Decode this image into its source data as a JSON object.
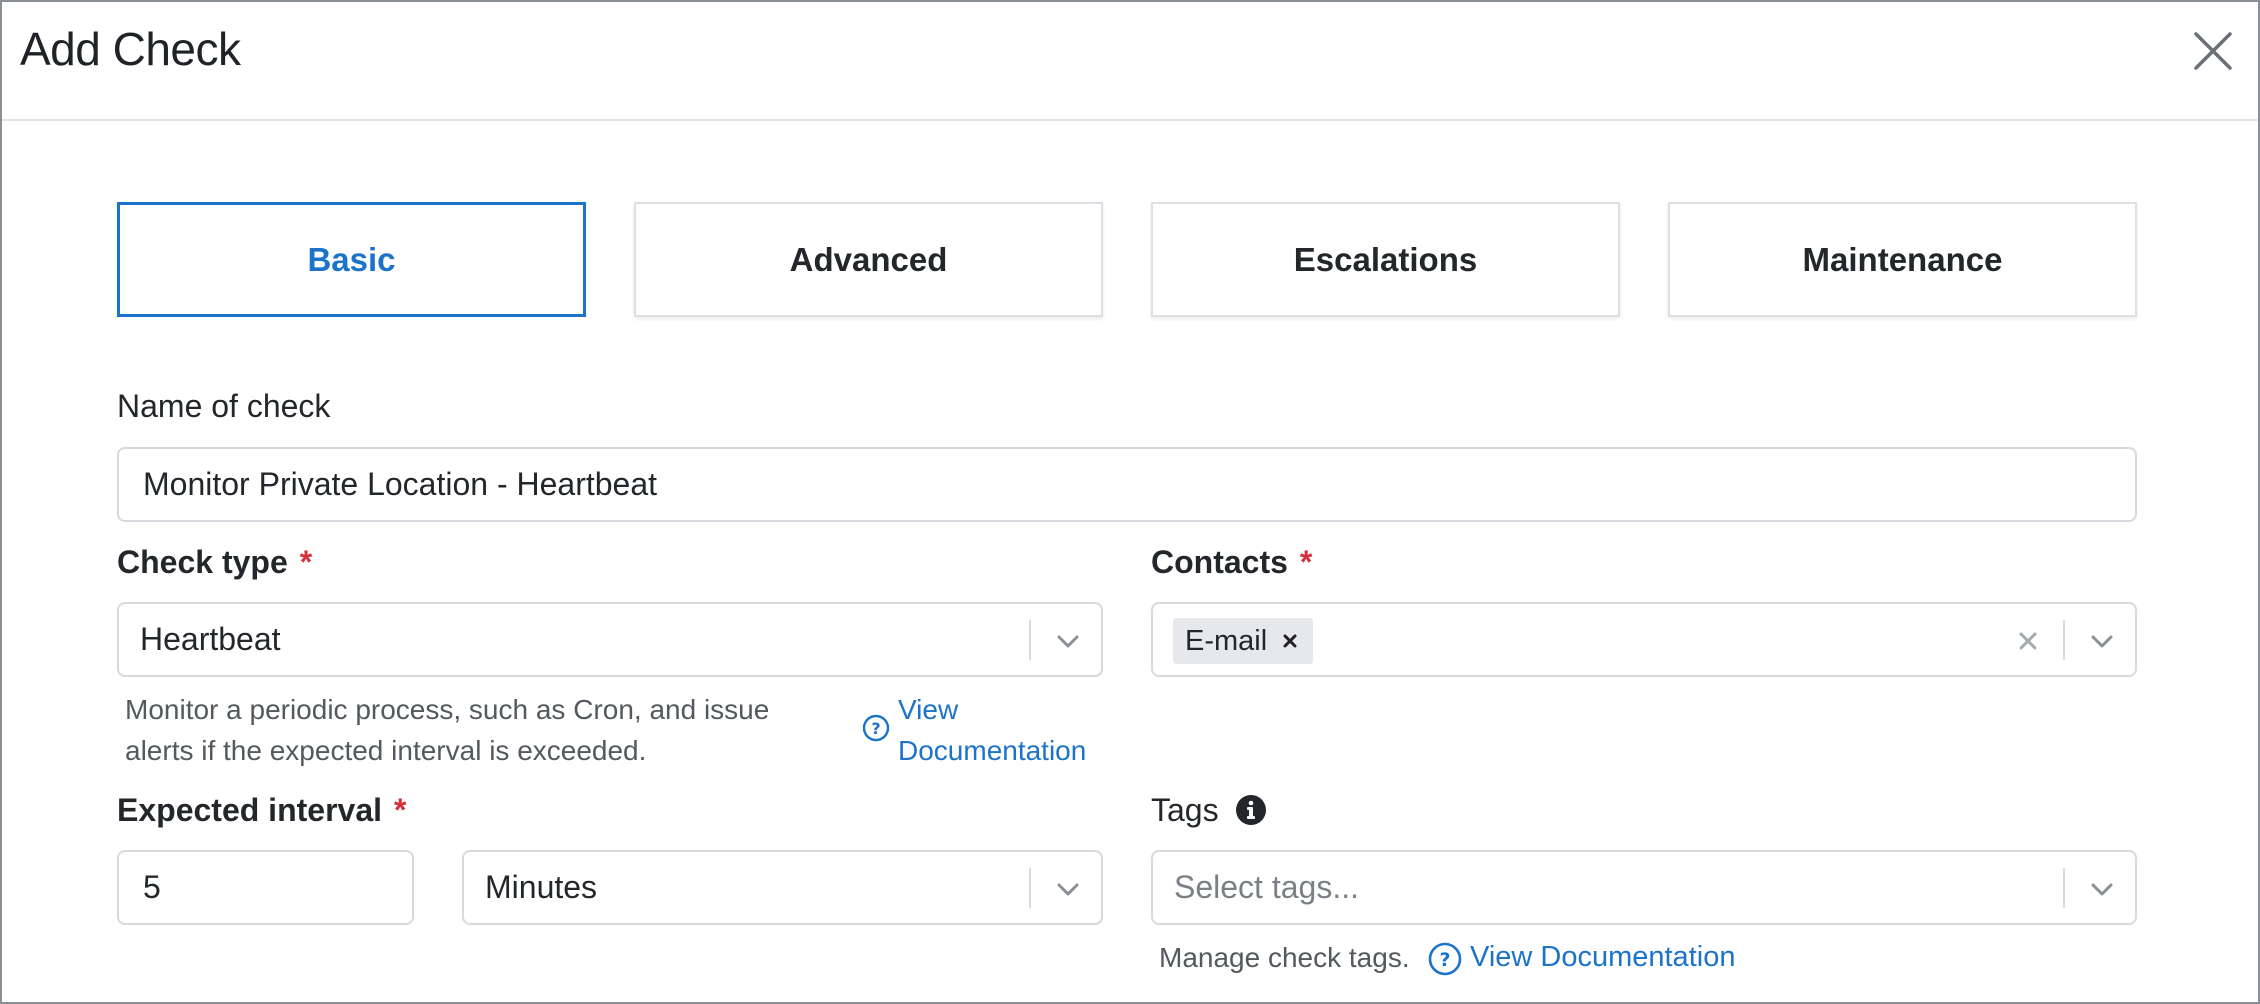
{
  "dialog": {
    "title": "Add Check",
    "close_icon": "close-icon"
  },
  "tabs": [
    {
      "label": "Basic",
      "active": true
    },
    {
      "label": "Advanced",
      "active": false
    },
    {
      "label": "Escalations",
      "active": false
    },
    {
      "label": "Maintenance",
      "active": false
    }
  ],
  "name": {
    "label": "Name of check",
    "value": "Monitor Private Location - Heartbeat"
  },
  "check_type": {
    "label": "Check type",
    "required_mark": "*",
    "value": "Heartbeat",
    "help_line1": "Monitor a periodic process, such as Cron, and issue",
    "help_line2": "alerts if the expected interval is exceeded.",
    "doc_link_line1": "View",
    "doc_link_line2": "Documentation"
  },
  "contacts": {
    "label": "Contacts",
    "required_mark": "*",
    "selected": [
      "E-mail"
    ]
  },
  "interval": {
    "label": "Expected interval",
    "required_mark": "*",
    "value": "5",
    "unit": "Minutes"
  },
  "tags": {
    "label": "Tags",
    "placeholder": "Select tags...",
    "help": "Manage check tags.",
    "doc_link": "View Documentation"
  },
  "colors": {
    "accent": "#1b74c9",
    "required": "#d62f3a",
    "border": "#d6d9dd"
  }
}
